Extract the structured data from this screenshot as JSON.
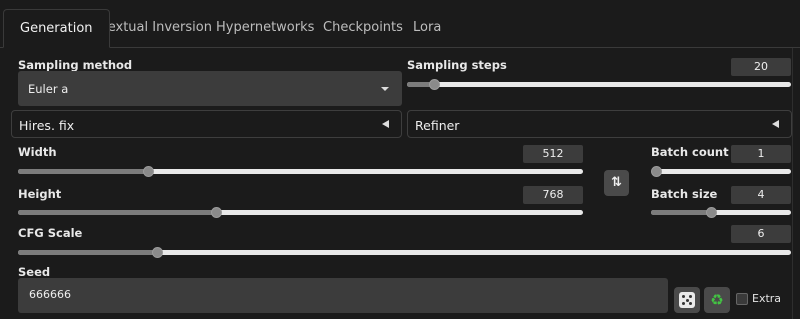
{
  "tabs": [
    {
      "label": "Generation",
      "active": true
    },
    {
      "label": "Textual Inversion",
      "active": false
    },
    {
      "label": "Hypernetworks",
      "active": false
    },
    {
      "label": "Checkpoints",
      "active": false
    },
    {
      "label": "Lora",
      "active": false
    }
  ],
  "sampling_method": {
    "label": "Sampling method",
    "value": "Euler a"
  },
  "sampling_steps": {
    "label": "Sampling steps",
    "value": "20",
    "fraction": 0.07
  },
  "hires_fix": {
    "label": "Hires. fix"
  },
  "refiner": {
    "label": "Refiner"
  },
  "width": {
    "label": "Width",
    "value": "512",
    "fraction": 0.23
  },
  "height": {
    "label": "Height",
    "value": "768",
    "fraction": 0.35
  },
  "swap_icon": "⇅",
  "batch_count": {
    "label": "Batch count",
    "value": "1",
    "fraction": 0.0
  },
  "batch_size": {
    "label": "Batch size",
    "value": "4",
    "fraction": 0.43
  },
  "cfg_scale": {
    "label": "CFG Scale",
    "value": "6",
    "fraction": 0.18
  },
  "seed": {
    "label": "Seed",
    "value": "666666",
    "recycle_glyph": "♻"
  },
  "extra": {
    "label": "Extra",
    "checked": false
  },
  "colors": {
    "background": "#1b1b1b",
    "input": "#3c3c3c",
    "button": "#4a4a4a",
    "slider_track": "#e9e9e9",
    "recycle": "#43c443"
  },
  "icons": [
    "dice-icon",
    "recycle-icon",
    "swap-icon",
    "chevron-down-icon",
    "collapse-left-icon"
  ]
}
